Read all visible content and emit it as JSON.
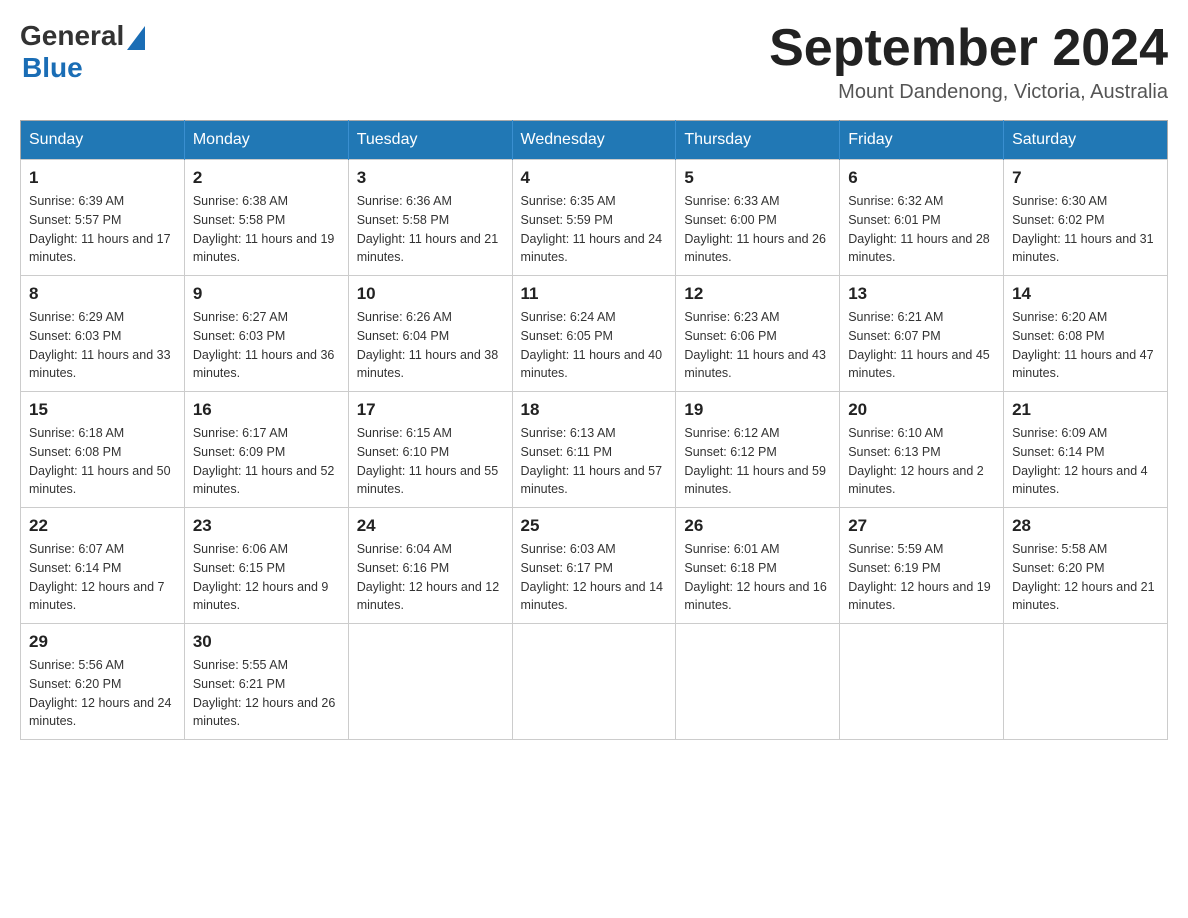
{
  "header": {
    "logo_general": "General",
    "logo_blue": "Blue",
    "month": "September 2024",
    "location": "Mount Dandenong, Victoria, Australia"
  },
  "days_of_week": [
    "Sunday",
    "Monday",
    "Tuesday",
    "Wednesday",
    "Thursday",
    "Friday",
    "Saturday"
  ],
  "weeks": [
    [
      {
        "day": "1",
        "sunrise": "Sunrise: 6:39 AM",
        "sunset": "Sunset: 5:57 PM",
        "daylight": "Daylight: 11 hours and 17 minutes."
      },
      {
        "day": "2",
        "sunrise": "Sunrise: 6:38 AM",
        "sunset": "Sunset: 5:58 PM",
        "daylight": "Daylight: 11 hours and 19 minutes."
      },
      {
        "day": "3",
        "sunrise": "Sunrise: 6:36 AM",
        "sunset": "Sunset: 5:58 PM",
        "daylight": "Daylight: 11 hours and 21 minutes."
      },
      {
        "day": "4",
        "sunrise": "Sunrise: 6:35 AM",
        "sunset": "Sunset: 5:59 PM",
        "daylight": "Daylight: 11 hours and 24 minutes."
      },
      {
        "day": "5",
        "sunrise": "Sunrise: 6:33 AM",
        "sunset": "Sunset: 6:00 PM",
        "daylight": "Daylight: 11 hours and 26 minutes."
      },
      {
        "day": "6",
        "sunrise": "Sunrise: 6:32 AM",
        "sunset": "Sunset: 6:01 PM",
        "daylight": "Daylight: 11 hours and 28 minutes."
      },
      {
        "day": "7",
        "sunrise": "Sunrise: 6:30 AM",
        "sunset": "Sunset: 6:02 PM",
        "daylight": "Daylight: 11 hours and 31 minutes."
      }
    ],
    [
      {
        "day": "8",
        "sunrise": "Sunrise: 6:29 AM",
        "sunset": "Sunset: 6:03 PM",
        "daylight": "Daylight: 11 hours and 33 minutes."
      },
      {
        "day": "9",
        "sunrise": "Sunrise: 6:27 AM",
        "sunset": "Sunset: 6:03 PM",
        "daylight": "Daylight: 11 hours and 36 minutes."
      },
      {
        "day": "10",
        "sunrise": "Sunrise: 6:26 AM",
        "sunset": "Sunset: 6:04 PM",
        "daylight": "Daylight: 11 hours and 38 minutes."
      },
      {
        "day": "11",
        "sunrise": "Sunrise: 6:24 AM",
        "sunset": "Sunset: 6:05 PM",
        "daylight": "Daylight: 11 hours and 40 minutes."
      },
      {
        "day": "12",
        "sunrise": "Sunrise: 6:23 AM",
        "sunset": "Sunset: 6:06 PM",
        "daylight": "Daylight: 11 hours and 43 minutes."
      },
      {
        "day": "13",
        "sunrise": "Sunrise: 6:21 AM",
        "sunset": "Sunset: 6:07 PM",
        "daylight": "Daylight: 11 hours and 45 minutes."
      },
      {
        "day": "14",
        "sunrise": "Sunrise: 6:20 AM",
        "sunset": "Sunset: 6:08 PM",
        "daylight": "Daylight: 11 hours and 47 minutes."
      }
    ],
    [
      {
        "day": "15",
        "sunrise": "Sunrise: 6:18 AM",
        "sunset": "Sunset: 6:08 PM",
        "daylight": "Daylight: 11 hours and 50 minutes."
      },
      {
        "day": "16",
        "sunrise": "Sunrise: 6:17 AM",
        "sunset": "Sunset: 6:09 PM",
        "daylight": "Daylight: 11 hours and 52 minutes."
      },
      {
        "day": "17",
        "sunrise": "Sunrise: 6:15 AM",
        "sunset": "Sunset: 6:10 PM",
        "daylight": "Daylight: 11 hours and 55 minutes."
      },
      {
        "day": "18",
        "sunrise": "Sunrise: 6:13 AM",
        "sunset": "Sunset: 6:11 PM",
        "daylight": "Daylight: 11 hours and 57 minutes."
      },
      {
        "day": "19",
        "sunrise": "Sunrise: 6:12 AM",
        "sunset": "Sunset: 6:12 PM",
        "daylight": "Daylight: 11 hours and 59 minutes."
      },
      {
        "day": "20",
        "sunrise": "Sunrise: 6:10 AM",
        "sunset": "Sunset: 6:13 PM",
        "daylight": "Daylight: 12 hours and 2 minutes."
      },
      {
        "day": "21",
        "sunrise": "Sunrise: 6:09 AM",
        "sunset": "Sunset: 6:14 PM",
        "daylight": "Daylight: 12 hours and 4 minutes."
      }
    ],
    [
      {
        "day": "22",
        "sunrise": "Sunrise: 6:07 AM",
        "sunset": "Sunset: 6:14 PM",
        "daylight": "Daylight: 12 hours and 7 minutes."
      },
      {
        "day": "23",
        "sunrise": "Sunrise: 6:06 AM",
        "sunset": "Sunset: 6:15 PM",
        "daylight": "Daylight: 12 hours and 9 minutes."
      },
      {
        "day": "24",
        "sunrise": "Sunrise: 6:04 AM",
        "sunset": "Sunset: 6:16 PM",
        "daylight": "Daylight: 12 hours and 12 minutes."
      },
      {
        "day": "25",
        "sunrise": "Sunrise: 6:03 AM",
        "sunset": "Sunset: 6:17 PM",
        "daylight": "Daylight: 12 hours and 14 minutes."
      },
      {
        "day": "26",
        "sunrise": "Sunrise: 6:01 AM",
        "sunset": "Sunset: 6:18 PM",
        "daylight": "Daylight: 12 hours and 16 minutes."
      },
      {
        "day": "27",
        "sunrise": "Sunrise: 5:59 AM",
        "sunset": "Sunset: 6:19 PM",
        "daylight": "Daylight: 12 hours and 19 minutes."
      },
      {
        "day": "28",
        "sunrise": "Sunrise: 5:58 AM",
        "sunset": "Sunset: 6:20 PM",
        "daylight": "Daylight: 12 hours and 21 minutes."
      }
    ],
    [
      {
        "day": "29",
        "sunrise": "Sunrise: 5:56 AM",
        "sunset": "Sunset: 6:20 PM",
        "daylight": "Daylight: 12 hours and 24 minutes."
      },
      {
        "day": "30",
        "sunrise": "Sunrise: 5:55 AM",
        "sunset": "Sunset: 6:21 PM",
        "daylight": "Daylight: 12 hours and 26 minutes."
      },
      null,
      null,
      null,
      null,
      null
    ]
  ]
}
